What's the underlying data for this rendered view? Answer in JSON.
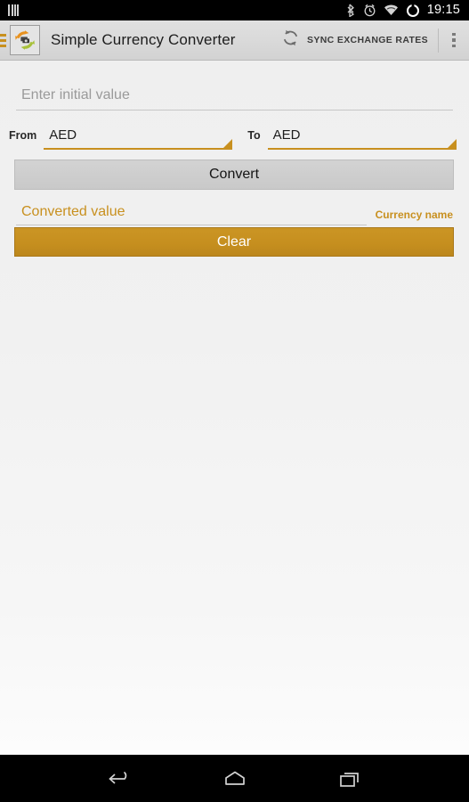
{
  "status_bar": {
    "sim_icon": "sim-card-icon",
    "bluetooth_icon": "bluetooth-icon",
    "alarm_icon": "alarm-clock-icon",
    "wifi_icon": "wifi-icon",
    "battery_icon": "battery-circle-icon",
    "clock": "19:15"
  },
  "app_bar": {
    "drawer_icon": "hamburger-menu-icon",
    "app_icon": "currency-exchange-app-icon",
    "title": "Simple Currency Converter",
    "sync_icon": "refresh-icon",
    "sync_label": "SYNC EXCHANGE RATES",
    "overflow_icon": "overflow-menu-icon"
  },
  "form": {
    "initial_value": "",
    "initial_value_placeholder": "Enter initial value",
    "from_label": "From",
    "from_currency": "AED",
    "to_label": "To",
    "to_currency": "AED",
    "convert_label": "Convert",
    "converted_value": "",
    "converted_value_placeholder": "Converted value",
    "currency_name": "Currency name",
    "clear_label": "Clear"
  },
  "nav_bar": {
    "back_icon": "back-arrow-icon",
    "home_icon": "home-icon",
    "recents_icon": "recent-apps-icon"
  },
  "colors": {
    "accent": "#c8901f",
    "app_bar_bg": "#d9d9d9",
    "content_bg": "#f1f1f1",
    "system_bg": "#000000"
  }
}
